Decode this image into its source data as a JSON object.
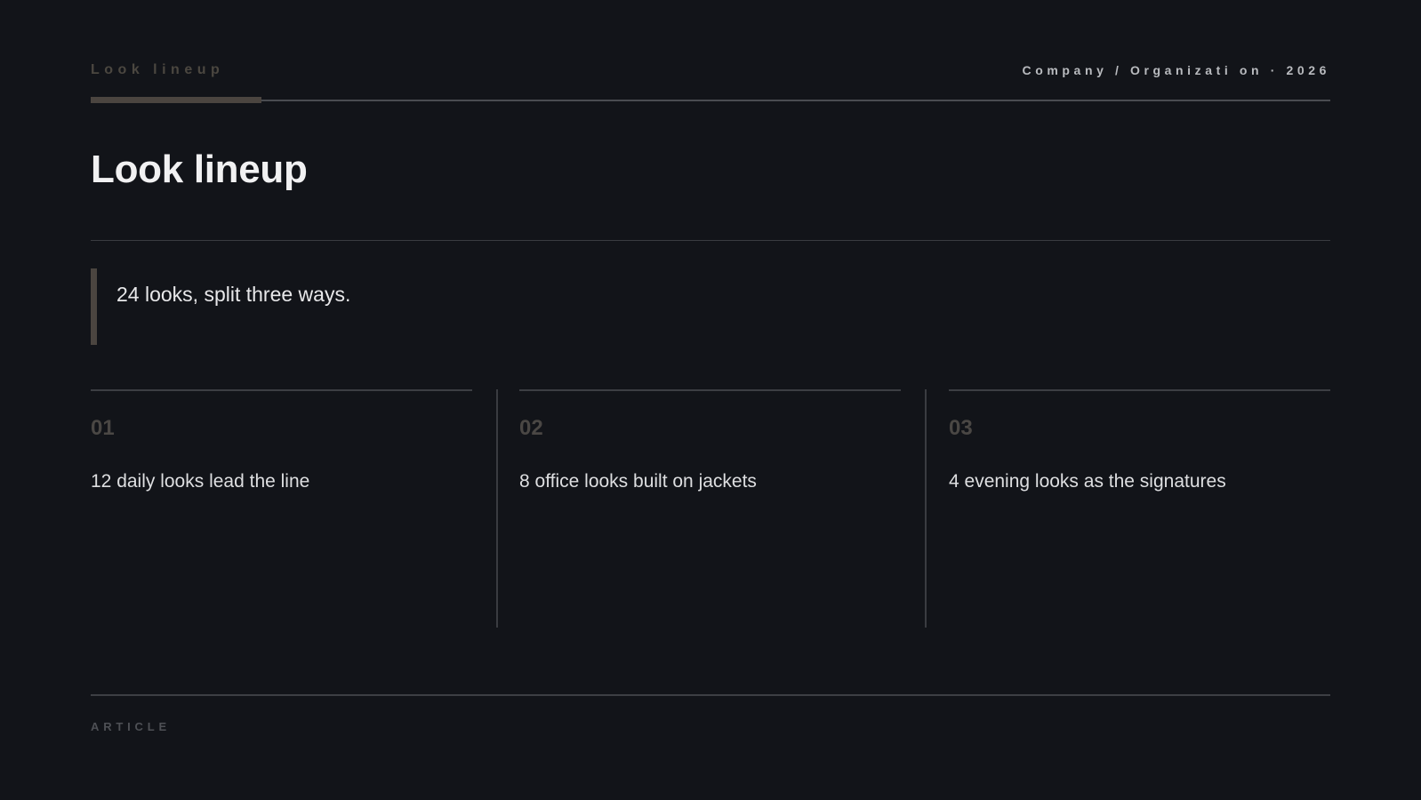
{
  "header": {
    "kicker": "Look lineup",
    "meta": "Company / Organizati on · 2026"
  },
  "title": "Look lineup",
  "quote": "24 looks, split three ways.",
  "columns": [
    {
      "number": "01",
      "text": "12 daily looks lead the line"
    },
    {
      "number": "02",
      "text": "8 office looks built on jackets"
    },
    {
      "number": "03",
      "text": "4 evening looks as the signatures"
    }
  ],
  "footer": {
    "label": "ARTICLE"
  },
  "colors": {
    "background": "#121419",
    "accent": "#4b4540",
    "text": "#e9e9ea"
  }
}
